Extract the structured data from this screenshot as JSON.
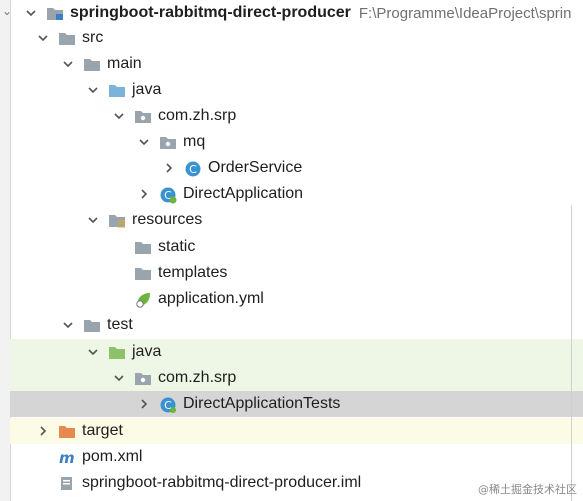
{
  "tree": {
    "project": {
      "name": "springboot-rabbitmq-direct-producer",
      "path": "F:\\Programme\\IdeaProject\\sprin"
    },
    "src": "src",
    "main": "main",
    "main_java": "java",
    "package_main": "com.zh.srp",
    "mq": "mq",
    "order_service": "OrderService",
    "direct_application": "DirectApplication",
    "resources": "resources",
    "static": "static",
    "templates": "templates",
    "application_yml": "application.yml",
    "test": "test",
    "test_java": "java",
    "package_test": "com.zh.srp",
    "direct_application_tests": "DirectApplicationTests",
    "target": "target",
    "pom": "pom.xml",
    "iml": "springboot-rabbitmq-direct-producer.iml"
  },
  "watermark": "@稀土掘金技术社区",
  "colors": {
    "folder_gray": "#9aa4ad",
    "source_folder_blue": "#7ab4d8",
    "test_folder_green": "#8cc26a",
    "excluded_folder_orange": "#e5894e",
    "class_icon_blue": "#3a92d0",
    "selection": "#d5d5d5",
    "test_row_bg": "#eef7e5",
    "excluded_row_bg": "#fbfbe6"
  }
}
